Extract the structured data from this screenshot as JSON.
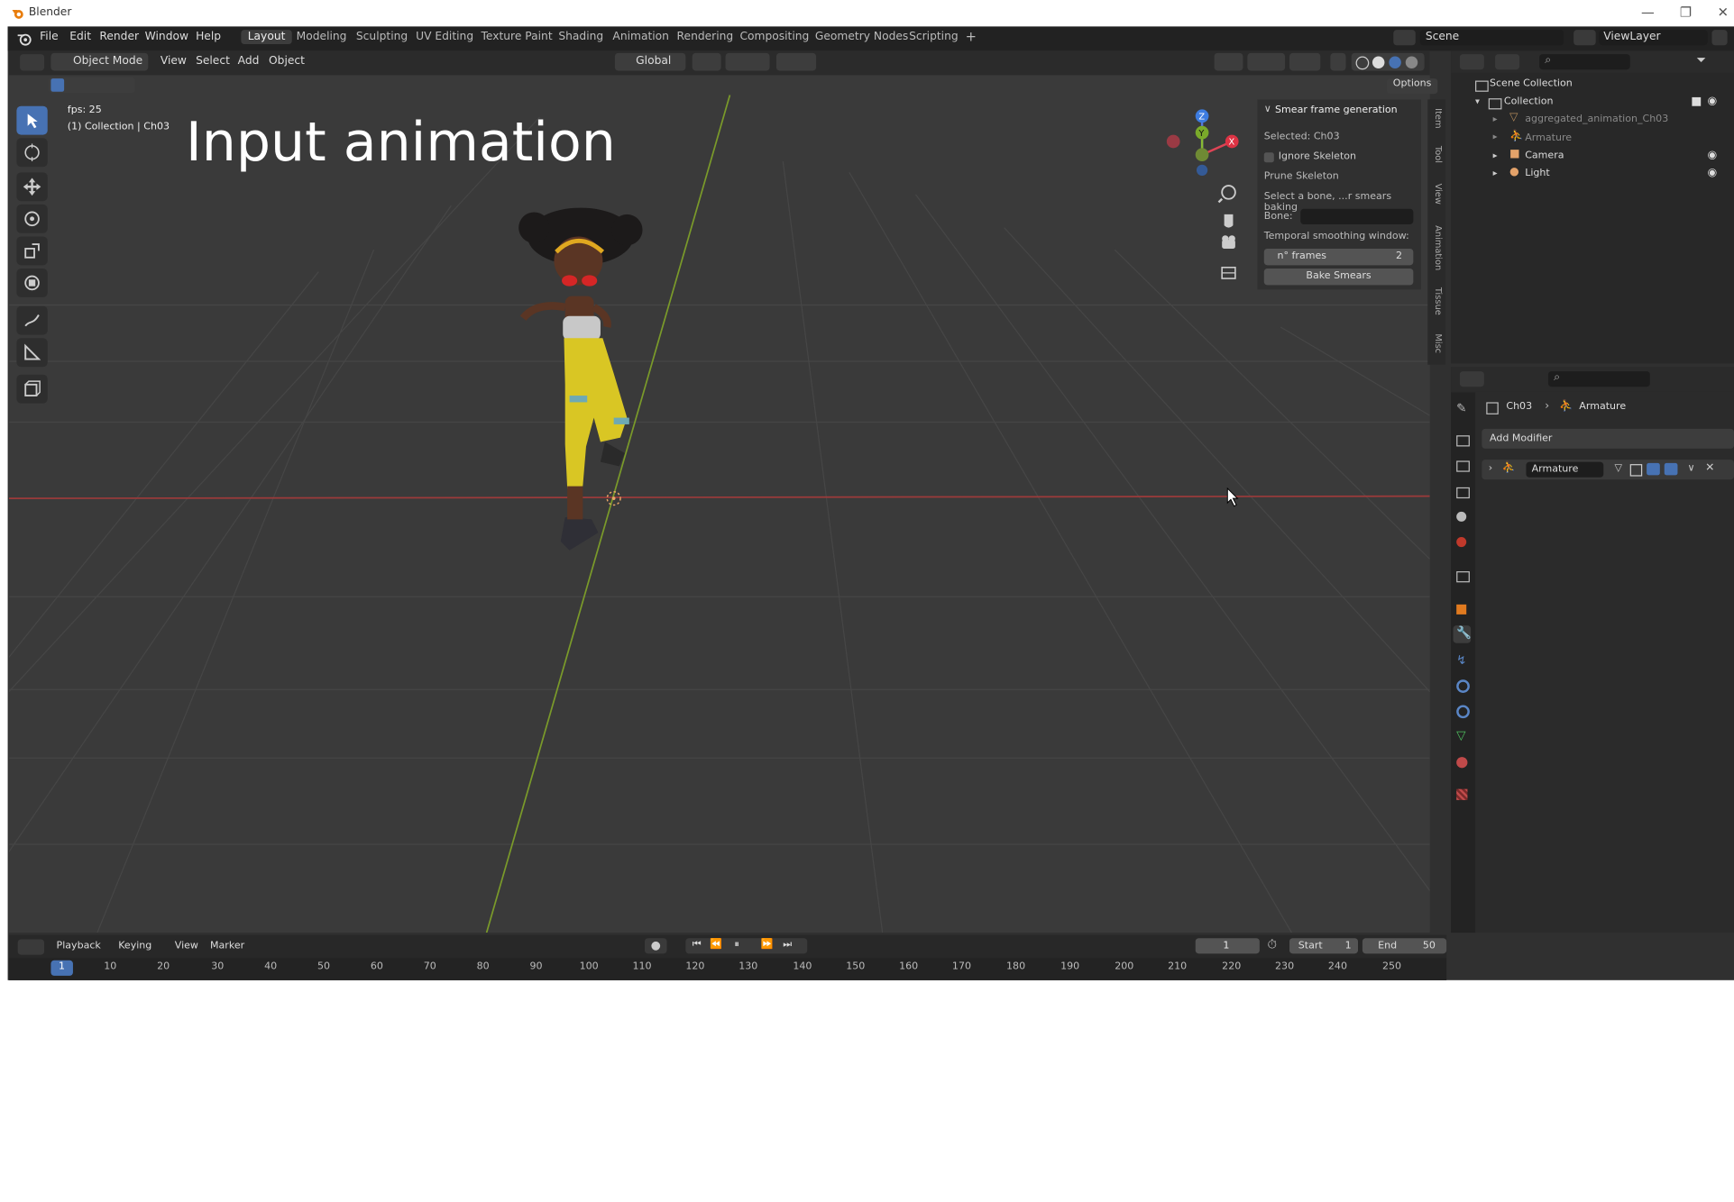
{
  "window": {
    "title": "Blender"
  },
  "menu": [
    "File",
    "Edit",
    "Render",
    "Window",
    "Help"
  ],
  "workspaces": [
    "Layout",
    "Modeling",
    "Sculpting",
    "UV Editing",
    "Texture Paint",
    "Shading",
    "Animation",
    "Rendering",
    "Compositing",
    "Geometry Nodes",
    "Scripting"
  ],
  "active_workspace": "Layout",
  "scene": {
    "name": "Scene",
    "view_layer": "ViewLayer"
  },
  "viewport": {
    "mode": "Object Mode",
    "menus": [
      "View",
      "Select",
      "Add",
      "Object"
    ],
    "orientation": "Global",
    "options_label": "Options",
    "fps_text": "fps: 25",
    "collection_text": "(1) Collection | Ch03",
    "overlay_title": "Input animation"
  },
  "npanel": {
    "header": "Smear frame generation",
    "selected": "Selected: Ch03",
    "ignore_skeleton": "Ignore Skeleton",
    "prune_skeleton": "Prune Skeleton",
    "select_bone_hint": "Select a bone, ...r smears baking",
    "bone_label": "Bone:",
    "temporal_label": "Temporal smoothing window:",
    "frames_label": "n° frames",
    "frames_value": "2",
    "bake_button": "Bake Smears",
    "tabs": [
      "Item",
      "Tool",
      "View",
      "Animation",
      "Tissue",
      "Misc"
    ]
  },
  "outliner": {
    "root": "Scene Collection",
    "collection": "Collection",
    "items": [
      "aggregated_animation_Ch03",
      "Armature",
      "Camera",
      "Light"
    ]
  },
  "properties": {
    "breadcrumb_object": "Ch03",
    "breadcrumb_data": "Armature",
    "add_modifier": "Add Modifier",
    "modifier_name": "Armature"
  },
  "timeline": {
    "menus": [
      "Playback",
      "Keying",
      "View",
      "Marker"
    ],
    "current_frame": "1",
    "start_label": "Start",
    "start_value": "1",
    "end_label": "End",
    "end_value": "50",
    "ticks": [
      "1",
      "10",
      "20",
      "30",
      "40",
      "50",
      "60",
      "70",
      "80",
      "90",
      "100",
      "110",
      "120",
      "130",
      "140",
      "150",
      "160",
      "170",
      "180",
      "190",
      "200",
      "210",
      "220",
      "230",
      "240",
      "250"
    ]
  },
  "colors": {
    "accent": "#4772b3",
    "x_axis": "#9c3a3a",
    "y_axis": "#7a9a2a",
    "background": "#3a3a3a"
  }
}
